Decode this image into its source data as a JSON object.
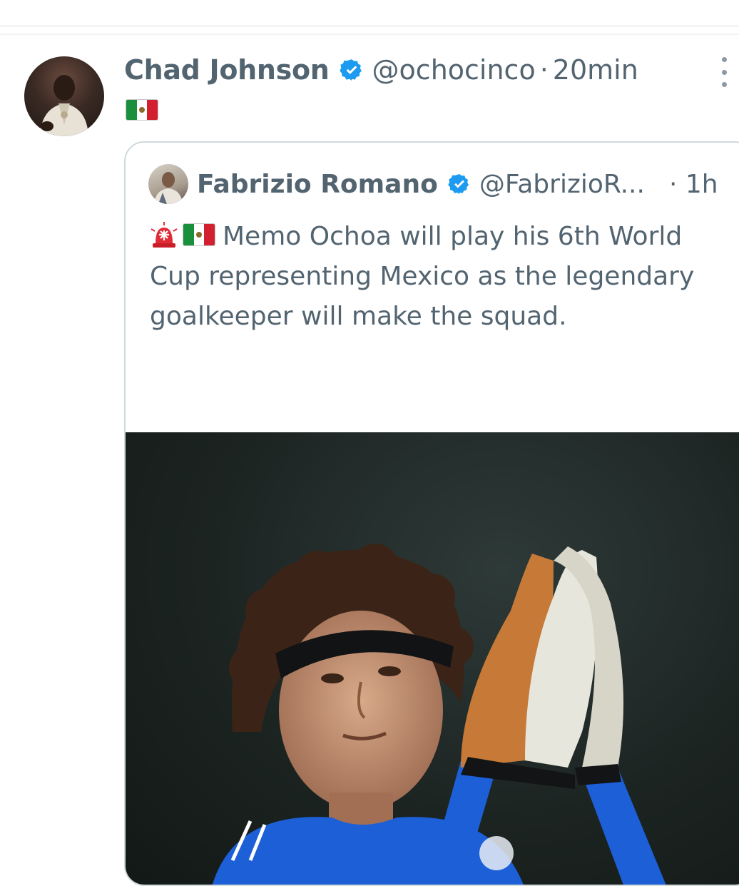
{
  "tweet": {
    "author_name": "Chad Johnson",
    "handle": "@ochocinco",
    "separator": "·",
    "time": "20min",
    "verified": true,
    "body_emoji": "mexico-flag",
    "avatar": "avatar-photo",
    "more_icon": "more-vertical-icon"
  },
  "quoted_tweet": {
    "author_name": "Fabrizio Romano",
    "handle": "@FabrizioR...",
    "time": "· 1h",
    "verified": true,
    "leading_emojis": [
      "siren-icon",
      "mexico-flag"
    ],
    "text": "Memo Ochoa will play his 6th World Cup representing Mexico as the legendary goalkeeper will make the squad.",
    "truncation": "...",
    "media": "goalkeeper-photo"
  },
  "colors": {
    "text_secondary": "#536471",
    "verified_blue": "#1d9bf0",
    "card_border": "#cfd9de",
    "jersey_blue": "#1c5fd6"
  }
}
